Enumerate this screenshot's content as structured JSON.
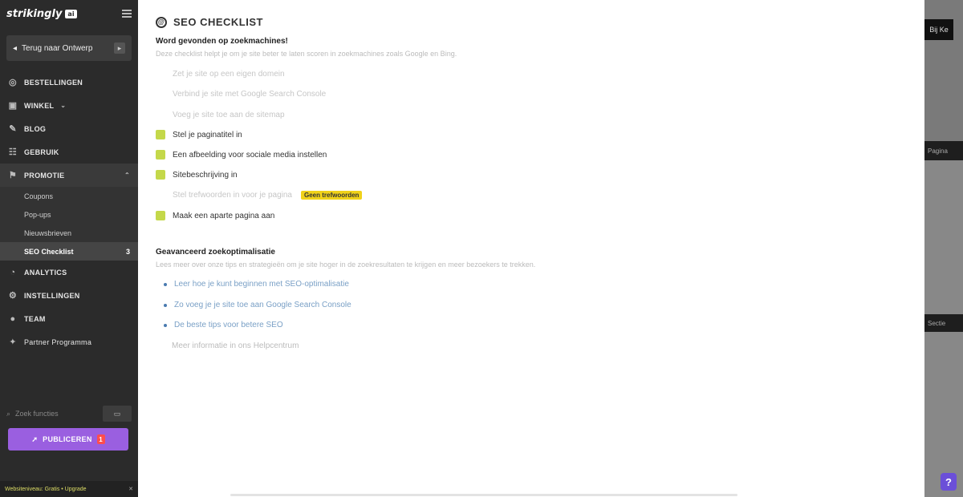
{
  "sidebar": {
    "logo": "strikingly",
    "logo_badge": "ai",
    "back_label": "Terug naar Ontwerp",
    "nav": [
      {
        "label": "BESTELLINGEN",
        "icon": "orders-icon"
      },
      {
        "label": "WINKEL",
        "icon": "store-icon"
      },
      {
        "label": "BLOG",
        "icon": "blog-icon"
      },
      {
        "label": "GEBRUIK",
        "icon": "audience-icon"
      }
    ],
    "promotion": {
      "label": "PROMOTIE",
      "icon": "promotion-icon"
    },
    "promotion_items": [
      {
        "label": "Coupons"
      },
      {
        "label": "Pop-ups"
      },
      {
        "label": "Nieuwsbrieven"
      },
      {
        "label": "SEO Checklist",
        "count": "3"
      }
    ],
    "nav_bottom": [
      {
        "label": "ANALYTICS",
        "icon": "analytics-icon"
      },
      {
        "label": "INSTELLINGEN",
        "icon": "settings-icon"
      },
      {
        "label": "TEAM",
        "icon": "team-icon"
      },
      {
        "label": "Partner Programma",
        "icon": "partner-icon"
      }
    ],
    "search_placeholder": "Zoek functies",
    "device_label": "▭",
    "publish_label": "PUBLICEREN",
    "publish_count": "1",
    "tip_text": "Websiteniveau: Gratis • Upgrade"
  },
  "main": {
    "title": "SEO CHECKLIST",
    "section1": {
      "title": "Word gevonden op zoekmachines!",
      "desc": "Deze checklist helpt je om je site beter te laten scoren in zoekmachines zoals Google en Bing."
    },
    "checklist": [
      {
        "label": "Zet je site op een eigen domein",
        "done": false
      },
      {
        "label": "Verbind je site met Google Search Console",
        "done": false
      },
      {
        "label": "Voeg je site toe aan de sitemap",
        "done": false
      },
      {
        "label": "Stel je paginatitel in",
        "done": true
      },
      {
        "label": "Een afbeelding voor sociale media instellen",
        "done": true
      },
      {
        "label": "Sitebeschrijving in",
        "done": true
      },
      {
        "label": "Stel trefwoorden in voor je pagina",
        "done": false,
        "pill": "Geen trefwoorden"
      },
      {
        "label": "Maak een aparte pagina aan",
        "done": true
      }
    ],
    "section2": {
      "title": "Geavanceerd zoekoptimalisatie",
      "desc": "Lees meer over onze tips en strategieën om je site hoger in de zoekresultaten te krijgen en meer bezoekers te trekken."
    },
    "links": [
      "Leer hoe je kunt beginnen met SEO-optimalisatie",
      "Zo voeg je je site toe aan Google Search Console",
      "De beste tips voor betere SEO"
    ],
    "footer_line": "Meer informatie in ons Helpcentrum"
  },
  "right": {
    "btn_label": "Bij Ke",
    "line1": "Pagina",
    "line2": "Sectie"
  },
  "colors": {
    "sidebar_bg": "#2b2b2b",
    "publish": "#9a5fe0",
    "check_done": "#c4d84a",
    "pill": "#f0d21a",
    "link": "#4a7bb0",
    "help": "#6b4fd8"
  }
}
